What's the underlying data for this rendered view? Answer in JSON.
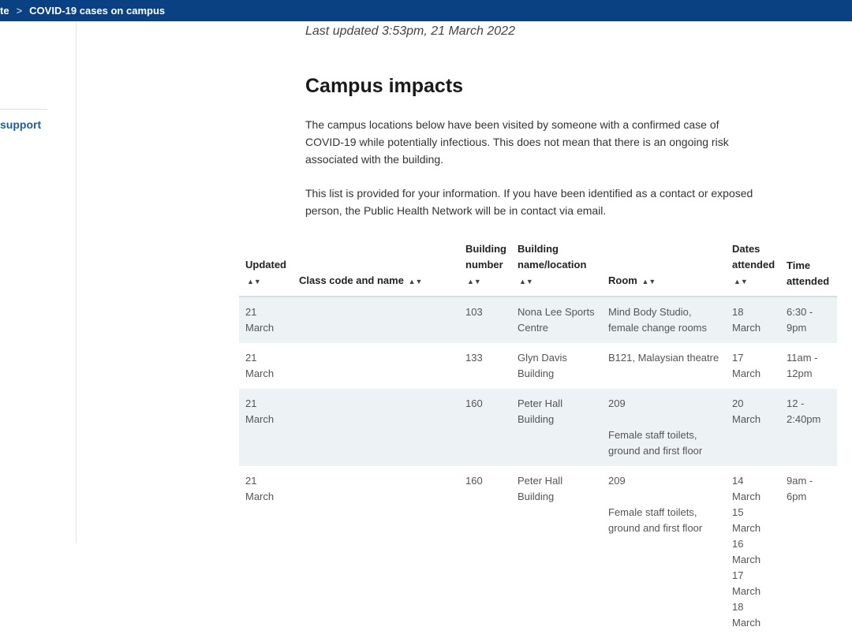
{
  "breadcrumb": {
    "parent": "te",
    "current": "COVID-19 cases on campus"
  },
  "sidebar": {
    "link_label": "support"
  },
  "main": {
    "last_updated": "Last updated 3:53pm, 21 March 2022",
    "heading": "Campus impacts",
    "paragraph_1": "The campus locations below have been visited by someone with a confirmed case of COVID-19 while potentially infectious. This does not mean that there is an ongoing risk associated with the building.",
    "paragraph_2": "This list is provided for your information. If you have been identified as a contact or exposed person, the Public Health Network will be in contact via email."
  },
  "table": {
    "sort_icon": "sort-icon",
    "headers": {
      "updated": "Updated",
      "class_code": "Class code and name",
      "building_number_1": "Building",
      "building_number_2": "number",
      "building_name_1": "Building",
      "building_name_2": "name/location",
      "room": "Room",
      "dates_1": "Dates",
      "dates_2": "attended",
      "time_1": "Time",
      "time_2": "attended"
    },
    "rows": [
      {
        "updated": "21 March",
        "class_code": "",
        "building_number": "103",
        "building_name": "Nona Lee Sports Centre",
        "room": "Mind Body Studio, female change rooms",
        "room_note": "",
        "dates": [
          "18 March"
        ],
        "time": "6:30 - 9pm"
      },
      {
        "updated": "21 March",
        "class_code": "",
        "building_number": "133",
        "building_name": "Glyn Davis Building",
        "room": "B121, Malaysian theatre",
        "room_note": "",
        "dates": [
          "17 March"
        ],
        "time": "11am - 12pm"
      },
      {
        "updated": "21 March",
        "class_code": "",
        "building_number": "160",
        "building_name": "Peter Hall Building",
        "room": "209",
        "room_note": "Female staff toilets, ground and first floor",
        "dates": [
          "20 March"
        ],
        "time": "12 - 2:40pm"
      },
      {
        "updated": "21 March",
        "class_code": "",
        "building_number": "160",
        "building_name": "Peter Hall Building",
        "room": "209",
        "room_note": "Female staff toilets, ground and first floor",
        "dates": [
          "14 March",
          "15 March",
          "16 March",
          "17 March",
          "18 March"
        ],
        "time": "9am - 6pm"
      }
    ]
  },
  "colors": {
    "topbar": "#094183",
    "link": "#1f5d99",
    "row_shade": "#edf2f5"
  }
}
